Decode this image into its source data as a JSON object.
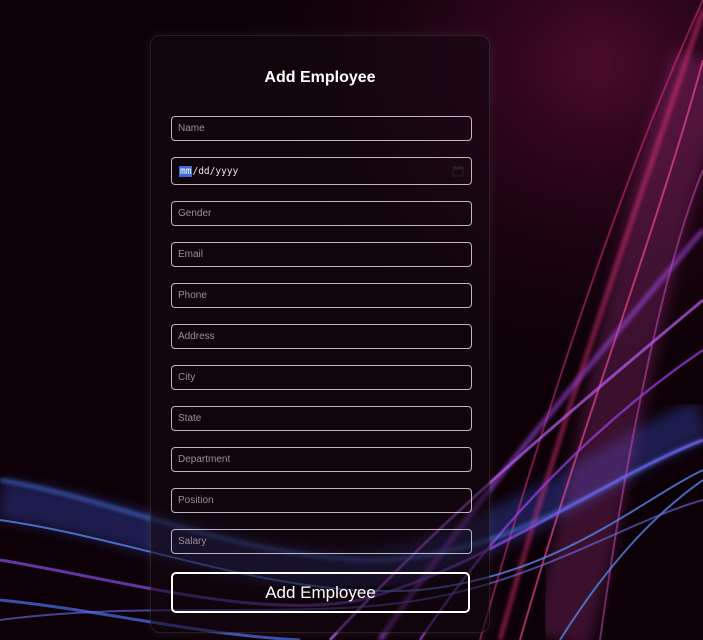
{
  "form": {
    "title": "Add Employee",
    "name_placeholder": "Name",
    "date_value": "mm/dd/yyyy",
    "date_segments": {
      "month": "mm",
      "sep1": "/",
      "day": "dd",
      "sep2": "/",
      "year": "yyyy"
    },
    "gender_placeholder": "Gender",
    "email_placeholder": "Email",
    "phone_placeholder": "Phone",
    "address_placeholder": "Address",
    "city_placeholder": "City",
    "state_placeholder": "State",
    "department_placeholder": "Department",
    "position_placeholder": "Position",
    "salary_placeholder": "Salary",
    "submit_label": "Add Employee"
  },
  "icons": {
    "date_picker": "calendar-icon"
  },
  "colors": {
    "background": "#0d0107",
    "accent_pink": "#e0357a",
    "accent_purple": "#a04ae0",
    "accent_blue": "#4f7ef0",
    "field_border": "#ebe1eb",
    "button_border": "#ffffff"
  }
}
